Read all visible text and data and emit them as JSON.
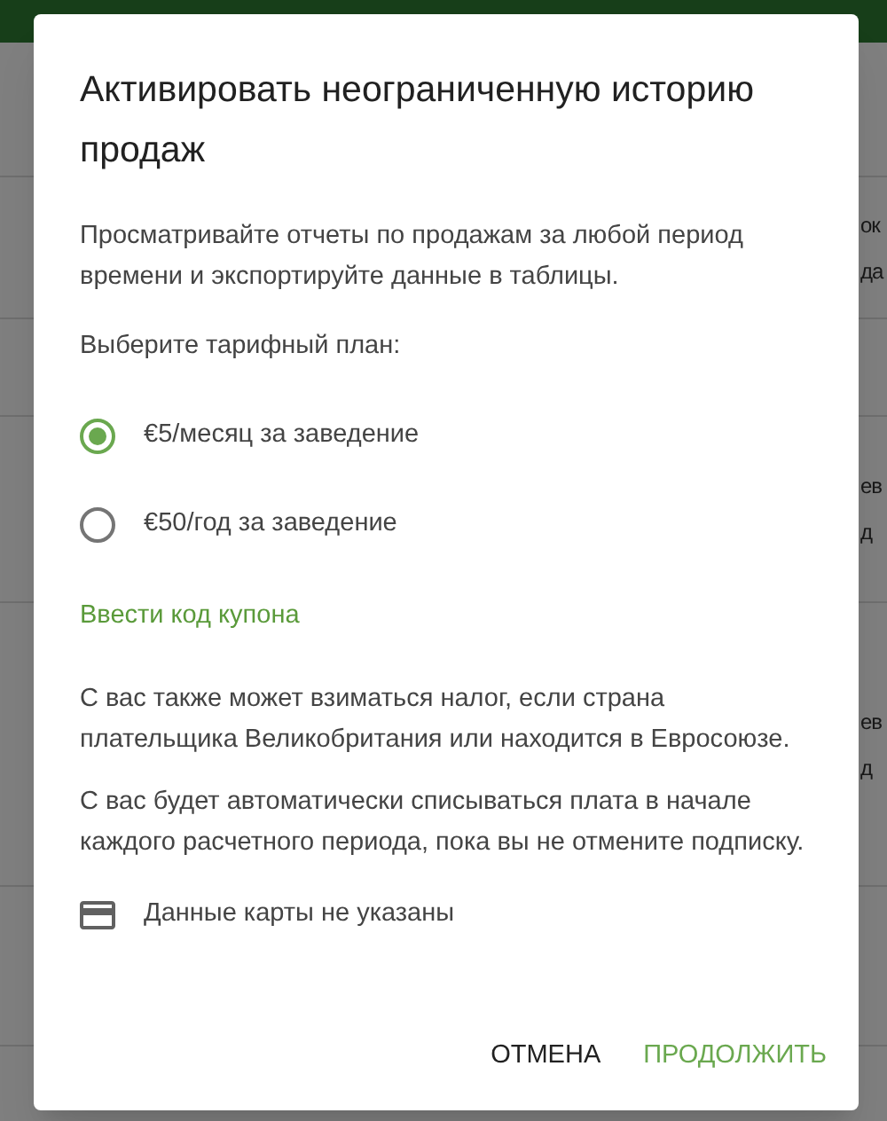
{
  "background": {
    "rows": [
      {
        "lines": []
      },
      {
        "lines": [
          "ок",
          "да"
        ]
      },
      {
        "lines": []
      },
      {
        "lines": [
          "ев",
          "д"
        ]
      },
      {
        "lines": [
          "ев",
          "д"
        ]
      },
      {
        "lines": []
      }
    ]
  },
  "dialog": {
    "title": "Активировать неограниченную историю продаж",
    "description": "Просматривайте отчеты по продажам за любой период времени и экспортируйте данные в таблицы.",
    "plan_label": "Выберите тарифный план:",
    "plans": [
      {
        "label": "€5/месяц за заведение",
        "selected": true
      },
      {
        "label": "€50/год за заведение",
        "selected": false
      }
    ],
    "coupon_link": "Ввести код купона",
    "notes": [
      "С вас также может взиматься налог, если страна плательщика Великобритания или находится в Евросоюзе.",
      "С вас будет автоматически списываться плата в начале каждого расчетного периода, пока вы не отмените подписку."
    ],
    "card_status": "Данные карты не указаны",
    "buttons": [
      {
        "label": "ОТМЕНА",
        "kind": "secondary"
      },
      {
        "label": "ПРОДОЛЖИТЬ",
        "kind": "primary"
      }
    ]
  }
}
